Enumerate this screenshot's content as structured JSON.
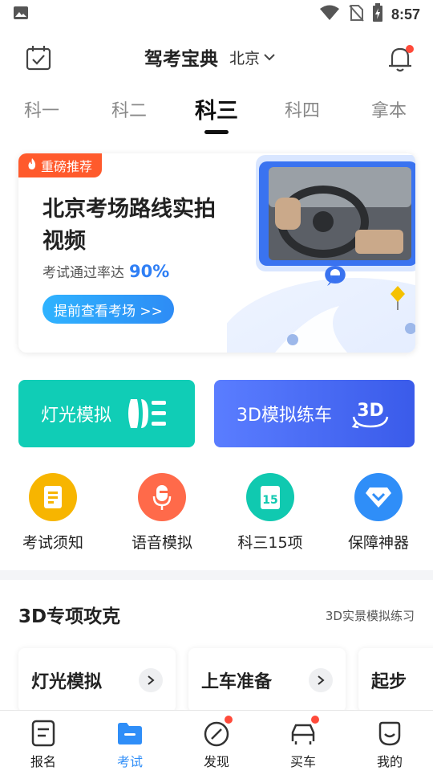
{
  "status_bar": {
    "time": "8:57"
  },
  "header": {
    "title": "驾考宝典",
    "city": "北京"
  },
  "tabs": [
    {
      "label": "科一",
      "active": false
    },
    {
      "label": "科二",
      "active": false
    },
    {
      "label": "科三",
      "active": true
    },
    {
      "label": "科四",
      "active": false
    },
    {
      "label": "拿本",
      "active": false
    }
  ],
  "banner": {
    "tag": "重磅推荐",
    "title": "北京考场路线实拍视频",
    "subtitle": "考试通过率达",
    "rate": "90%",
    "button": "提前查看考场 >>"
  },
  "big_buttons": {
    "light": "灯光模拟",
    "threed": "3D模拟练车"
  },
  "quick_links": [
    {
      "label": "考试须知",
      "icon": "document-icon",
      "color": "#f7b500"
    },
    {
      "label": "语音模拟",
      "icon": "microphone-icon",
      "color": "#ff6a4a"
    },
    {
      "label": "科三15项",
      "icon": "calendar-15-icon",
      "color": "#10c9b0"
    },
    {
      "label": "保障神器",
      "icon": "diamond-shield-icon",
      "color": "#2f8ef8"
    }
  ],
  "section": {
    "title": "3D专项攻克",
    "more": "3D实景模拟练习"
  },
  "cards": [
    {
      "label": "灯光模拟"
    },
    {
      "label": "上车准备"
    },
    {
      "label": "起步"
    }
  ],
  "bottom_nav": [
    {
      "label": "报名",
      "active": false,
      "dot": false
    },
    {
      "label": "考试",
      "active": true,
      "dot": false
    },
    {
      "label": "发现",
      "active": false,
      "dot": true
    },
    {
      "label": "买车",
      "active": false,
      "dot": true
    },
    {
      "label": "我的",
      "active": false,
      "dot": false
    }
  ],
  "colors": {
    "accent": "#2f8ef8",
    "teal": "#10cdb6",
    "tag": "#ff5a2c",
    "badge": "#ff4a3a"
  }
}
